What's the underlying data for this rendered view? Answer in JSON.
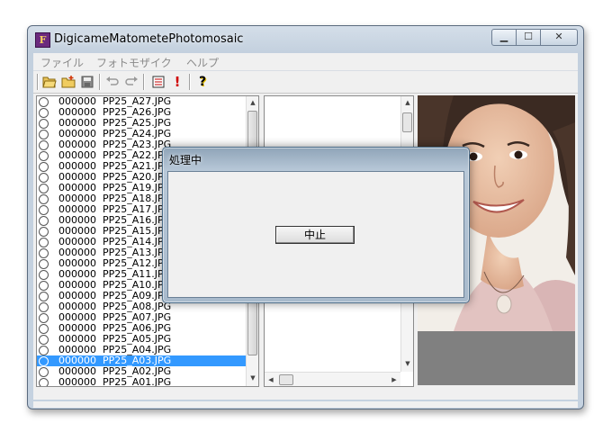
{
  "window": {
    "title": "DigicameMatometePhotomosaic",
    "app_icon_letter": "F"
  },
  "menu": {
    "file": "ファイル",
    "mosaic": "フォトモザイク",
    "help": "ヘルプ"
  },
  "toolbar": {
    "icons": [
      "open-folder-icon",
      "new-folder-icon",
      "save-icon",
      "undo-icon",
      "redo-icon",
      "list-icon",
      "exclamation-icon",
      "help-icon"
    ]
  },
  "file_list": {
    "rows": [
      {
        "code": "000000",
        "name": "PP25_A27.JPG"
      },
      {
        "code": "000000",
        "name": "PP25_A26.JPG"
      },
      {
        "code": "000000",
        "name": "PP25_A25.JPG"
      },
      {
        "code": "000000",
        "name": "PP25_A24.JPG"
      },
      {
        "code": "000000",
        "name": "PP25_A23.JPG"
      },
      {
        "code": "000000",
        "name": "PP25_A22.JPG"
      },
      {
        "code": "000000",
        "name": "PP25_A21.JPG"
      },
      {
        "code": "000000",
        "name": "PP25_A20.JPG"
      },
      {
        "code": "000000",
        "name": "PP25_A19.JPG"
      },
      {
        "code": "000000",
        "name": "PP25_A18.JPG"
      },
      {
        "code": "000000",
        "name": "PP25_A17.JPG"
      },
      {
        "code": "000000",
        "name": "PP25_A16.JPG"
      },
      {
        "code": "000000",
        "name": "PP25_A15.JPG"
      },
      {
        "code": "000000",
        "name": "PP25_A14.JPG"
      },
      {
        "code": "000000",
        "name": "PP25_A13.JPG"
      },
      {
        "code": "000000",
        "name": "PP25_A12.JPG"
      },
      {
        "code": "000000",
        "name": "PP25_A11.JPG"
      },
      {
        "code": "000000",
        "name": "PP25_A10.JPG"
      },
      {
        "code": "000000",
        "name": "PP25_A09.JPG"
      },
      {
        "code": "000000",
        "name": "PP25_A08.JPG"
      },
      {
        "code": "000000",
        "name": "PP25_A07.JPG"
      },
      {
        "code": "000000",
        "name": "PP25_A06.JPG"
      },
      {
        "code": "000000",
        "name": "PP25_A05.JPG"
      },
      {
        "code": "000000",
        "name": "PP25_A04.JPG"
      },
      {
        "code": "000000",
        "name": "PP25_A03.JPG"
      },
      {
        "code": "000000",
        "name": "PP25_A02.JPG"
      },
      {
        "code": "000000",
        "name": "PP25_A01.JPG"
      }
    ],
    "selected_name": "PP25_A03.JPG"
  },
  "dialog": {
    "title": "処理中",
    "cancel_label": "中止"
  },
  "colors": {
    "selection": "#3399ff"
  }
}
